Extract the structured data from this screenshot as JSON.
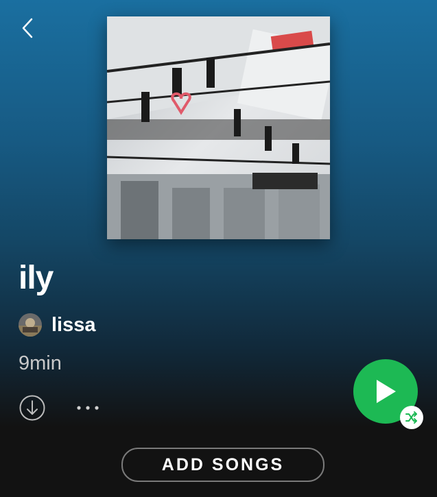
{
  "navigation": {
    "back_icon": "chevron-left-icon"
  },
  "playlist": {
    "title": "ily",
    "owner": {
      "name": "lissa",
      "avatar_icon": "user-avatar-photo"
    },
    "duration": "9min",
    "cover_description": "photo artwork"
  },
  "actions": {
    "download_icon": "download-circle-icon",
    "more_icon": "more-horizontal-icon",
    "play_icon": "play-icon",
    "shuffle_icon": "shuffle-icon",
    "add_songs_label": "ADD SONGS"
  },
  "colors": {
    "accent": "#1db954",
    "header_top": "#1a6fa0",
    "background": "#121212",
    "secondary_text": "#c9c9c9"
  }
}
